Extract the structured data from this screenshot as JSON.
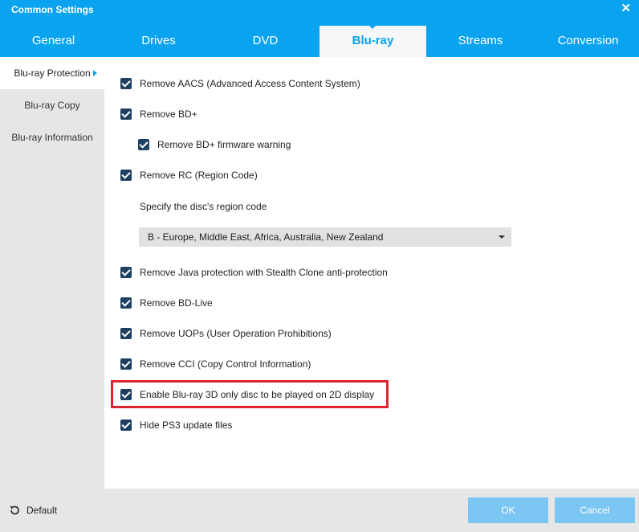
{
  "window": {
    "title": "Common Settings"
  },
  "tabs": [
    {
      "label": "General"
    },
    {
      "label": "Drives"
    },
    {
      "label": "DVD"
    },
    {
      "label": "Blu-ray",
      "active": true
    },
    {
      "label": "Streams"
    },
    {
      "label": "Conversion"
    }
  ],
  "sidebar": {
    "items": [
      {
        "label": "Blu-ray Protection",
        "active": true
      },
      {
        "label": "Blu-ray Copy"
      },
      {
        "label": "Blu-ray Information"
      }
    ]
  },
  "options": {
    "aacs": {
      "label": "Remove AACS (Advanced Access Content System)",
      "checked": true
    },
    "bdplus": {
      "label": "Remove BD+",
      "checked": true
    },
    "bdplus_firmware": {
      "label": "Remove BD+ firmware warning",
      "checked": true
    },
    "rc": {
      "label": "Remove RC (Region Code)",
      "checked": true
    },
    "java": {
      "label": "Remove Java protection with Stealth Clone anti-protection",
      "checked": true
    },
    "bdlive": {
      "label": "Remove BD-Live",
      "checked": true
    },
    "uops": {
      "label": "Remove UOPs (User Operation Prohibitions)",
      "checked": true
    },
    "cci": {
      "label": "Remove CCI (Copy Control Information)",
      "checked": true
    },
    "bluray3d": {
      "label": "Enable Blu-ray 3D only disc to be played on 2D display",
      "checked": true
    },
    "ps3": {
      "label": "Hide PS3 update files",
      "checked": true
    }
  },
  "region": {
    "label": "Specify the disc's region code",
    "selected": "B - Europe, Middle East, Africa, Australia, New Zealand"
  },
  "footer": {
    "default_label": "Default",
    "ok_label": "OK",
    "cancel_label": "Cancel"
  },
  "colors": {
    "accent": "#0aa3f0",
    "checkbox": "#1f3f61",
    "highlight": "#e0232e",
    "button": "#7cc6f3"
  },
  "icons": {
    "close": "close-icon",
    "undo": "undo-icon",
    "check": "check-icon",
    "dropdown": "chevron-down-icon"
  }
}
